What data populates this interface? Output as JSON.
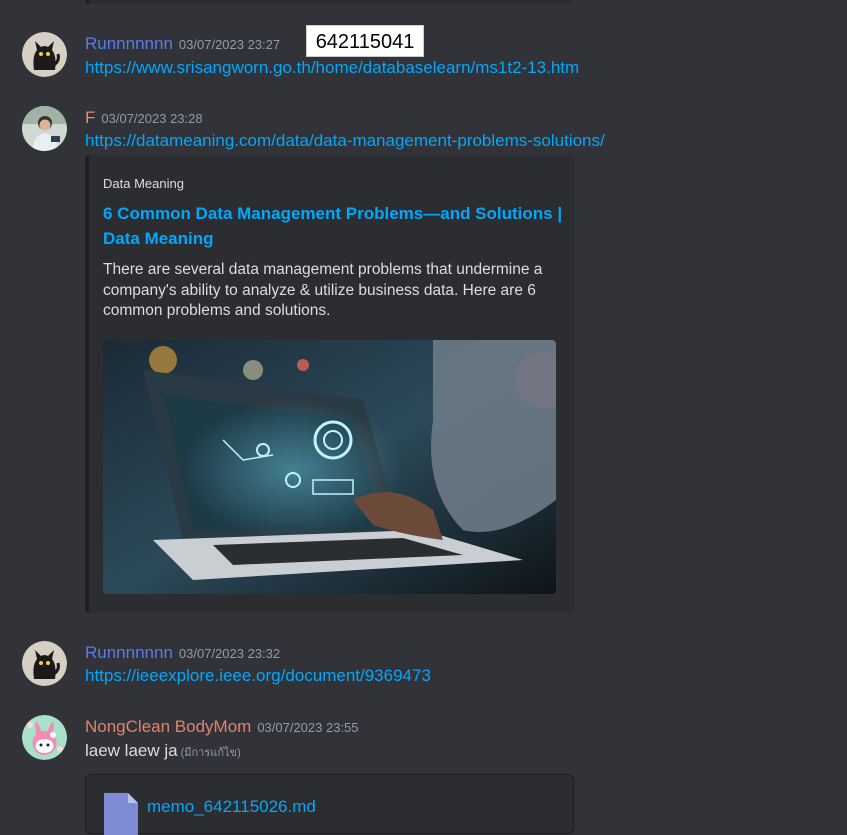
{
  "sticker_label": "642115041",
  "colors": {
    "background": "#313338",
    "link": "#00a8fc",
    "name_runnnnnnn": "#5b7bea",
    "name_f": "#f0896b",
    "name_nongclean": "#e3836b",
    "timestamp": "#949ba4"
  },
  "messages": [
    {
      "author": "Runnnnnnn",
      "timestamp": "03/07/2023 23:27",
      "link": "https://www.srisangworn.go.th/home/databaselearn/ms1t2-13.htm",
      "avatar_icon": "black-cat-avatar-icon"
    },
    {
      "author": "F",
      "timestamp": "03/07/2023 23:28",
      "link": "https://datameaning.com/data/data-management-problems-solutions/",
      "avatar_icon": "person-photo-avatar-icon",
      "embed": {
        "provider": "Data Meaning",
        "title": "6 Common Data Management Problems—and Solutions | Data Meaning",
        "description": "There are several data management problems that undermine a company's ability to analyze & utilize business data. Here are 6 common problems and solutions.",
        "image_icon": "laptop-data-analytics-image"
      }
    },
    {
      "author": "Runnnnnnn",
      "timestamp": "03/07/2023 23:32",
      "link": "https://ieeexplore.ieee.org/document/9369473",
      "avatar_icon": "black-cat-avatar-icon"
    },
    {
      "author": "NongClean BodyMom",
      "timestamp": "03/07/2023 23:55",
      "text": "laew laew ja",
      "edited": "(มีการแก้ไข)",
      "avatar_icon": "pink-rabbit-avatar-icon",
      "attachment": {
        "name": "memo_642115026.md",
        "icon": "document-file-icon"
      }
    }
  ]
}
